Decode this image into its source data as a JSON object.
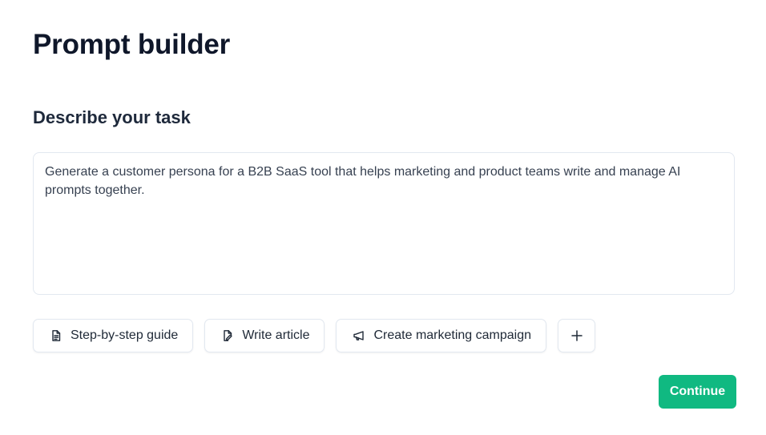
{
  "page": {
    "title": "Prompt builder",
    "subtitle": "Describe your task"
  },
  "task": {
    "value": "Generate a customer persona for a B2B SaaS tool that helps marketing and product teams write and manage AI prompts together."
  },
  "templates": [
    {
      "label": "Step-by-step guide",
      "icon": "document-icon"
    },
    {
      "label": "Write article",
      "icon": "file-edit-icon"
    },
    {
      "label": "Create marketing campaign",
      "icon": "megaphone-icon"
    }
  ],
  "add_template": {
    "icon": "plus-icon"
  },
  "actions": {
    "continue_label": "Continue"
  },
  "colors": {
    "accent": "#10b981",
    "border": "#e2e8f0",
    "heading": "#0f172a"
  }
}
